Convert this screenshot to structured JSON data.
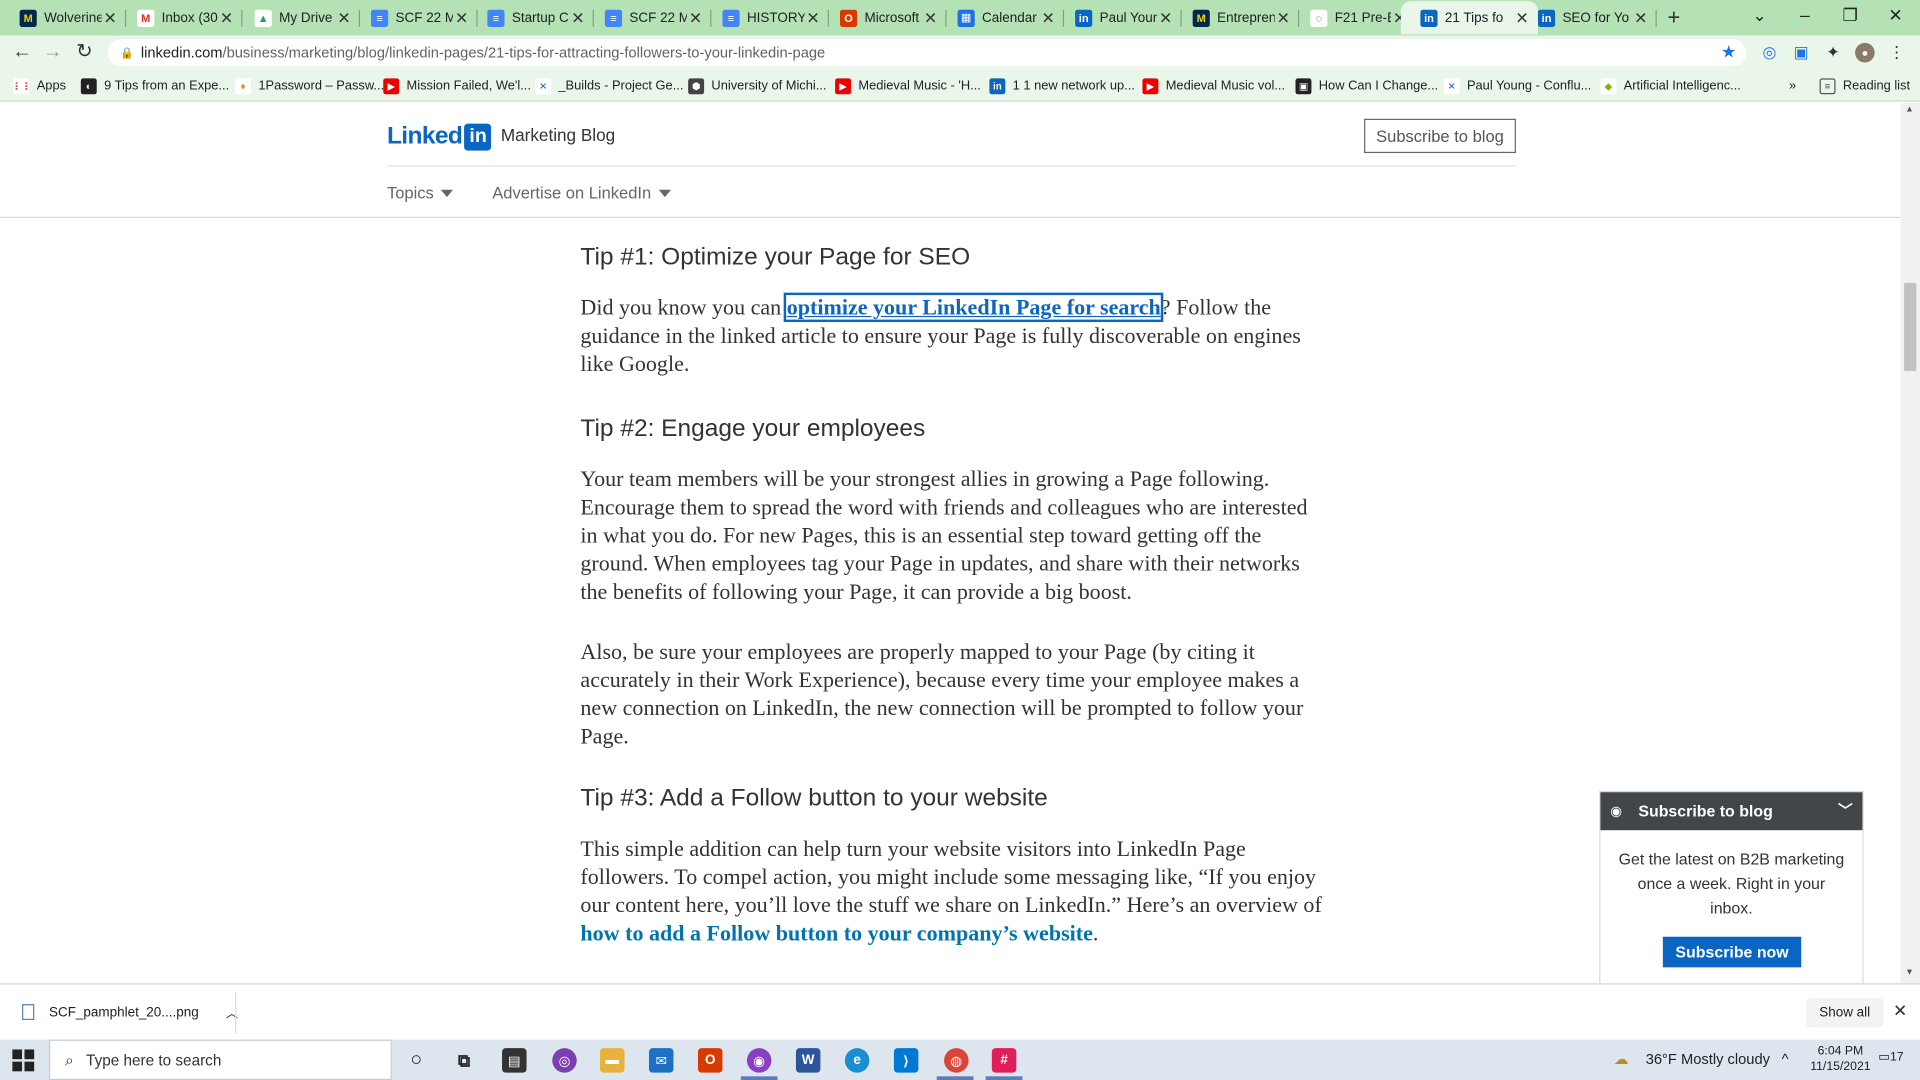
{
  "browser": {
    "tabs": [
      {
        "label": "Wolverine",
        "icon": "umich-icon"
      },
      {
        "label": "Inbox (30",
        "icon": "gmail-icon"
      },
      {
        "label": "My Drive",
        "icon": "drive-icon"
      },
      {
        "label": "SCF 22 M",
        "icon": "docs-icon"
      },
      {
        "label": "Startup C",
        "icon": "docs-icon"
      },
      {
        "label": "SCF 22 M",
        "icon": "docs-icon"
      },
      {
        "label": "HISTORY",
        "icon": "docs-icon"
      },
      {
        "label": "Microsoft",
        "icon": "office-icon"
      },
      {
        "label": "Calendar",
        "icon": "calendar-icon"
      },
      {
        "label": "Paul Youn",
        "icon": "linkedin-icon"
      },
      {
        "label": "Entrepren",
        "icon": "umich-icon"
      },
      {
        "label": "F21 Pre-B",
        "icon": "globe-icon"
      },
      {
        "label": "21 Tips fo",
        "icon": "linkedin-icon",
        "active": true
      },
      {
        "label": "SEO for Yo",
        "icon": "linkedin-icon"
      }
    ],
    "url_domain": "linkedin.com",
    "url_path": "/business/marketing/blog/linkedin-pages/21-tips-for-attracting-followers-to-your-linkedin-page",
    "bookmarks": [
      {
        "label": "Apps"
      },
      {
        "label": "9 Tips from an Expe..."
      },
      {
        "label": "1Password – Passw..."
      },
      {
        "label": "Mission Failed, We'l..."
      },
      {
        "label": "_Builds - Project Ge..."
      },
      {
        "label": "University of Michi..."
      },
      {
        "label": "Medieval Music - 'H..."
      },
      {
        "label": "1 1 new network up..."
      },
      {
        "label": "Medieval Music vol..."
      },
      {
        "label": "How Can I Change..."
      },
      {
        "label": "Paul Young - Conflu..."
      },
      {
        "label": "Artificial Intelligenc..."
      }
    ],
    "bookmarks_overflow": "»",
    "reading_list": "Reading list"
  },
  "site": {
    "logo_word": "Linked",
    "logo_in": "in",
    "blog_name": "Marketing Blog",
    "subscribe_label": "Subscribe to blog",
    "nav": [
      "Topics",
      "Advertise on LinkedIn"
    ]
  },
  "article": {
    "tip1_heading": "Tip #1: Optimize your Page for SEO",
    "tip1_pre": "Did you know you can ",
    "tip1_link": "optimize your LinkedIn Page for search",
    "tip1_post": "? Follow the guidance in the linked article to ensure your Page is fully discoverable on engines like Google.",
    "tip2_heading": "Tip #2: Engage your employees",
    "tip2_p1": "Your team members will be your strongest allies in growing a Page following. Encourage them to spread the word with friends and colleagues who are interested in what you do. For new Pages, this is an essential step toward getting off the ground. When employees tag your Page in updates, and share with their networks the benefits of following your Page, it can provide a big boost.",
    "tip2_p2": "Also, be sure your employees are properly mapped to your Page (by citing it accurately in their Work Experience), because every time your employee makes a new connection on LinkedIn, the new connection will be prompted to follow your Page.",
    "tip3_heading": "Tip #3: Add a Follow button to your website",
    "tip3_pre": "This simple addition can help turn your website visitors into LinkedIn Page followers. To compel action, you might include some messaging like, “If you enjoy our content here, you’ll love the stuff we share on LinkedIn.” Here’s an overview of ",
    "tip3_link": "how to add a Follow button to your company’s website",
    "tip3_post": "."
  },
  "subscribe_widget": {
    "title": "Subscribe to blog",
    "body": "Get the latest on B2B marketing once a week. Right in your inbox.",
    "button": "Subscribe now"
  },
  "downloads": {
    "file": "SCF_pamphlet_20....png",
    "show_all": "Show all"
  },
  "taskbar": {
    "search_placeholder": "Type here to search",
    "weather": "36°F  Mostly cloudy",
    "time": "6:04 PM",
    "date": "11/15/2021",
    "notifications": "17"
  }
}
